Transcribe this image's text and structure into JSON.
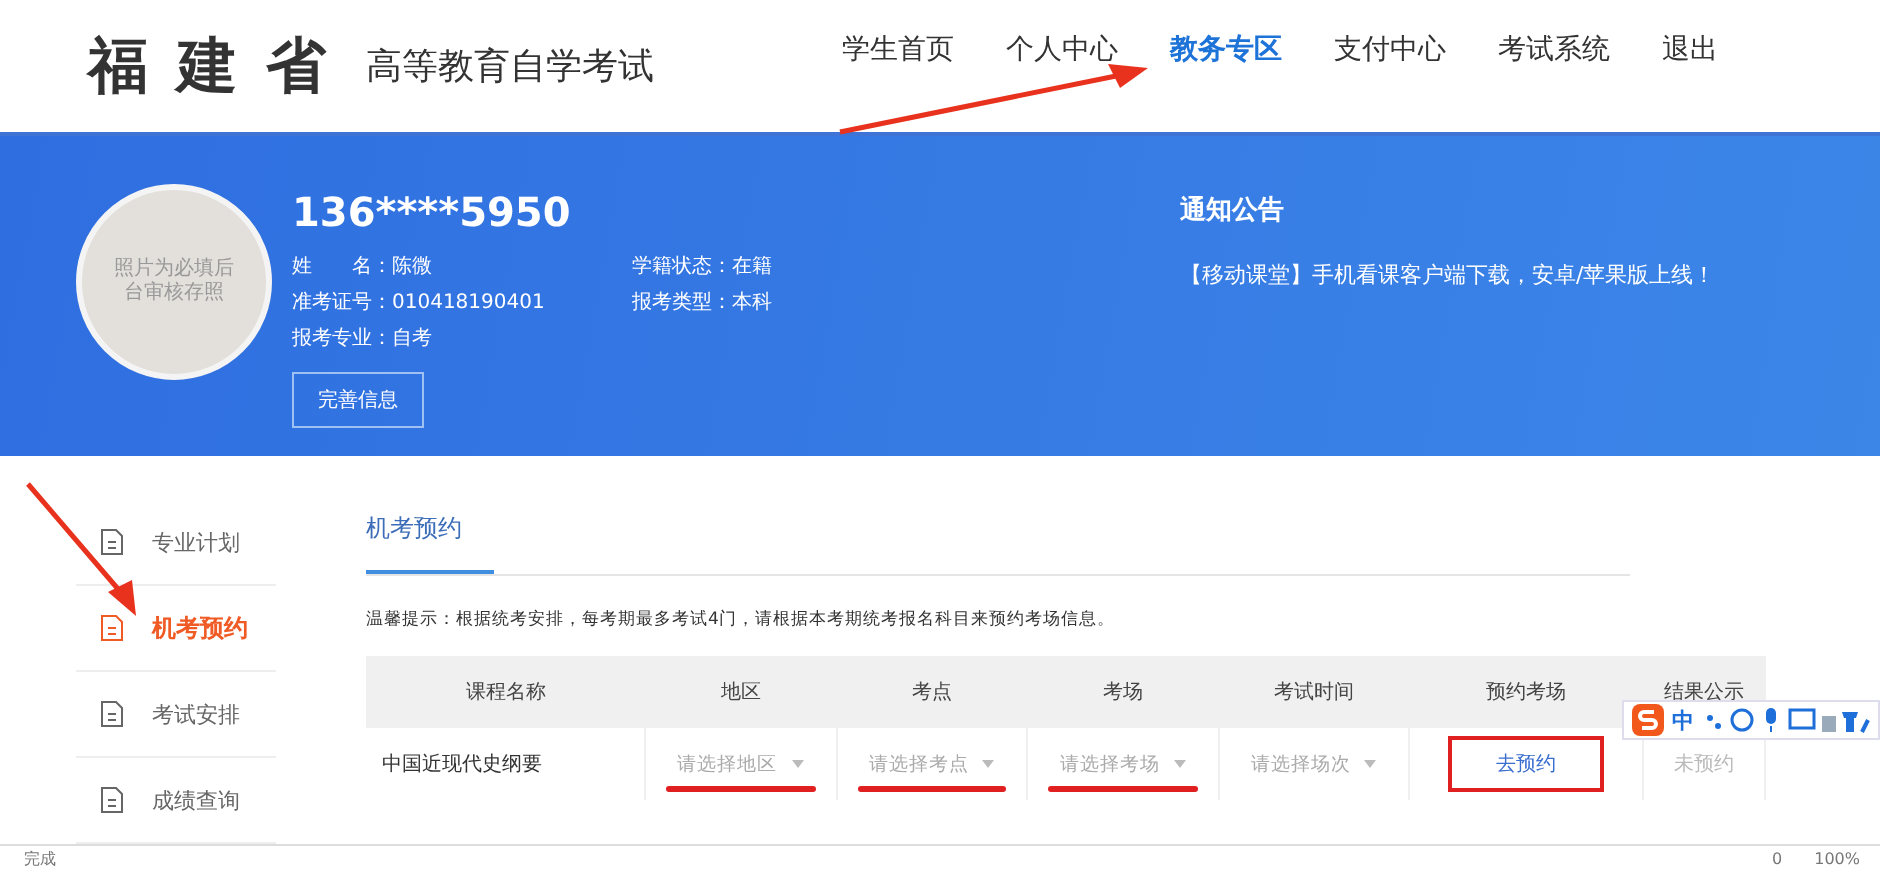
{
  "header": {
    "logo": "福 建 省",
    "site_title": "高等教育自学考试",
    "nav": [
      {
        "label": "学生首页",
        "selected": false
      },
      {
        "label": "个人中心",
        "selected": false
      },
      {
        "label": "教务专区",
        "selected": true
      },
      {
        "label": "支付中心",
        "selected": false
      },
      {
        "label": "考试系统",
        "selected": false
      },
      {
        "label": "退出",
        "selected": false
      }
    ]
  },
  "profile": {
    "avatar_text": "照片为必填后台审核存照",
    "phone": "136****5950",
    "fields": [
      {
        "label": "姓　　名：",
        "value": "陈微"
      },
      {
        "label": "学籍状态：",
        "value": "在籍"
      },
      {
        "label": "准考证号：",
        "value": "010418190401"
      },
      {
        "label": "报考类型：",
        "value": "本科"
      },
      {
        "label": "报考专业：",
        "value": "自考"
      }
    ],
    "edit_button": "完善信息"
  },
  "notice": {
    "title": "通知公告",
    "text": "【移动课堂】手机看课客户端下载，安卓/苹果版上线！"
  },
  "sidebar": {
    "items": [
      {
        "label": "专业计划",
        "selected": false
      },
      {
        "label": "机考预约",
        "selected": true
      },
      {
        "label": "考试安排",
        "selected": false
      },
      {
        "label": "成绩查询",
        "selected": false
      }
    ]
  },
  "tabs": [
    {
      "label": "机考预约",
      "selected": true
    }
  ],
  "tip": "温馨提示：根据统考安排，每考期最多考试4门，请根据本考期统考报名科目来预约考场信息。",
  "table": {
    "columns": [
      "课程名称",
      "地区",
      "考点",
      "考场",
      "考试时间",
      "预约考场",
      "结果公示"
    ],
    "rows": [
      {
        "course": "中国近现代史纲要",
        "selects": [
          {
            "placeholder": "请选择地区",
            "marked": true
          },
          {
            "placeholder": "请选择考点",
            "marked": true
          },
          {
            "placeholder": "请选择考场",
            "marked": true
          },
          {
            "placeholder": "请选择场次",
            "marked": false
          }
        ],
        "action": "去预约",
        "action_marked": true,
        "result": "未预约",
        "result_disabled": true
      }
    ]
  },
  "ime_toolbar": {
    "mode": "中"
  },
  "status_bar": {
    "text": "完成",
    "count": "0",
    "zoom": "100%"
  }
}
